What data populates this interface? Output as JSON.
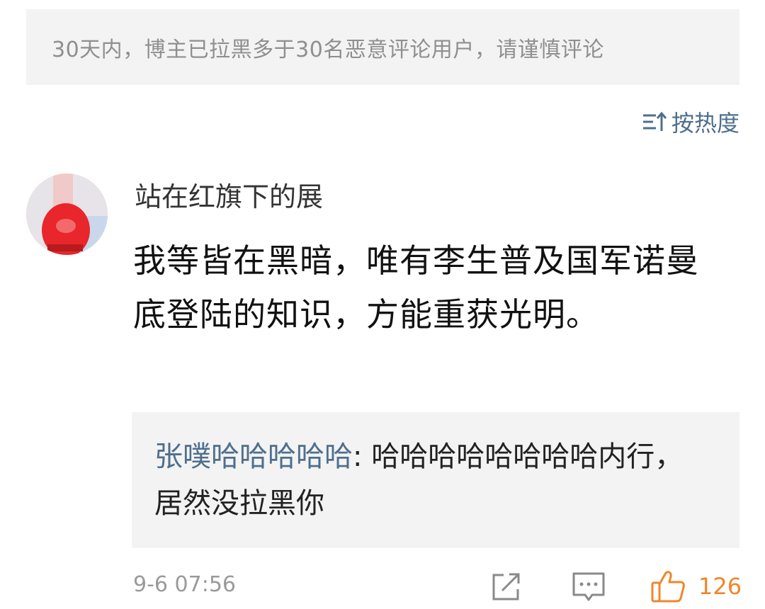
{
  "notice": {
    "text": "30天内，博主已拉黑多于30名恶意评论用户，请谨慎评论"
  },
  "sort": {
    "label": "按热度",
    "icon": "sort-icon",
    "color": "#4e6f8d"
  },
  "comment": {
    "avatar_icon": "avatar",
    "username": "站在红旗下的展",
    "content": "我等皆在黑暗，唯有李生普及国军诺曼底登陆的知识，方能重获光明。",
    "reply": {
      "user": "张噗哈哈哈哈哈",
      "separator": ": ",
      "text": "哈哈哈哈哈哈哈哈内行，居然没拉黑你"
    },
    "time": "9-6 07:56",
    "actions": {
      "share_icon": "share-icon",
      "comment_icon": "comment-icon",
      "like_icon": "thumbs-up-icon",
      "like_count": "126",
      "like_color": "#f0872a"
    }
  }
}
